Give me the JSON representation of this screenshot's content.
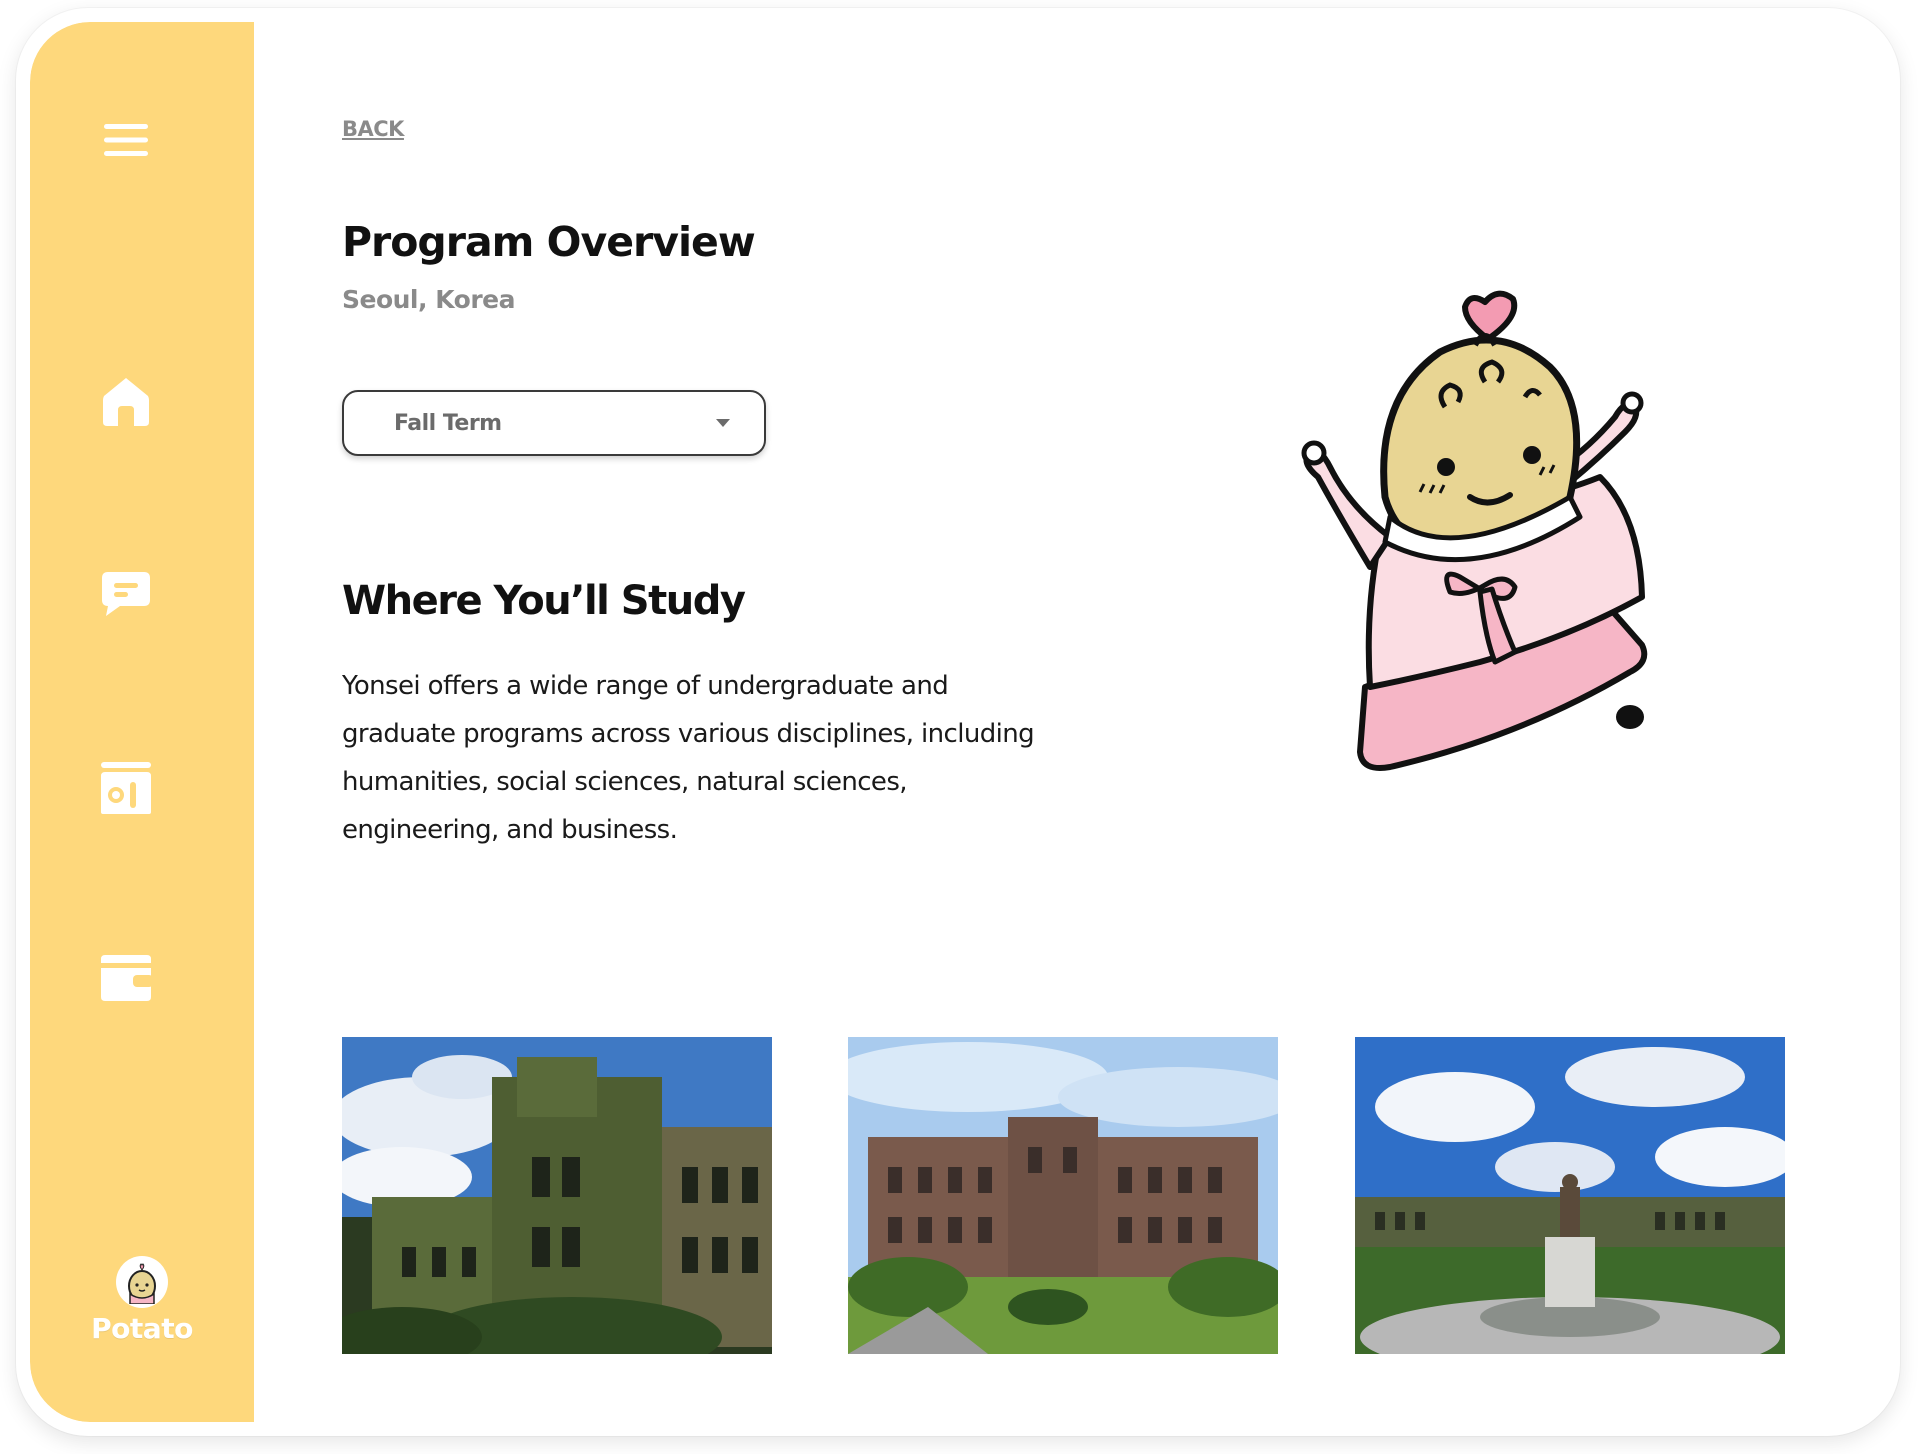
{
  "sidebar": {
    "menu_icon": "hamburger-menu-icon",
    "items": [
      {
        "name": "home",
        "icon": "home-icon"
      },
      {
        "name": "messages",
        "icon": "chat-bubble-icon"
      },
      {
        "name": "id-card",
        "icon": "id-card-icon"
      },
      {
        "name": "wallet",
        "icon": "wallet-icon"
      }
    ],
    "profile": {
      "name": "Potato",
      "icon": "potato-avatar-icon"
    }
  },
  "header": {
    "back_label": "BACK"
  },
  "program": {
    "title": "Program Overview",
    "location": "Seoul, Korea",
    "term_select": {
      "value": "Fall Term"
    }
  },
  "study": {
    "title": "Where You’ll Study",
    "description": "Yonsei offers a wide range of undergraduate and graduate programs across various disciplines, including humanities, social sciences, natural sciences, engineering, and business."
  },
  "colors": {
    "sidebar": "#fed87c",
    "mascot_skin": "#e8d593",
    "mascot_dress": "#fbd3dc",
    "mascot_skirt": "#f6b6c6"
  }
}
